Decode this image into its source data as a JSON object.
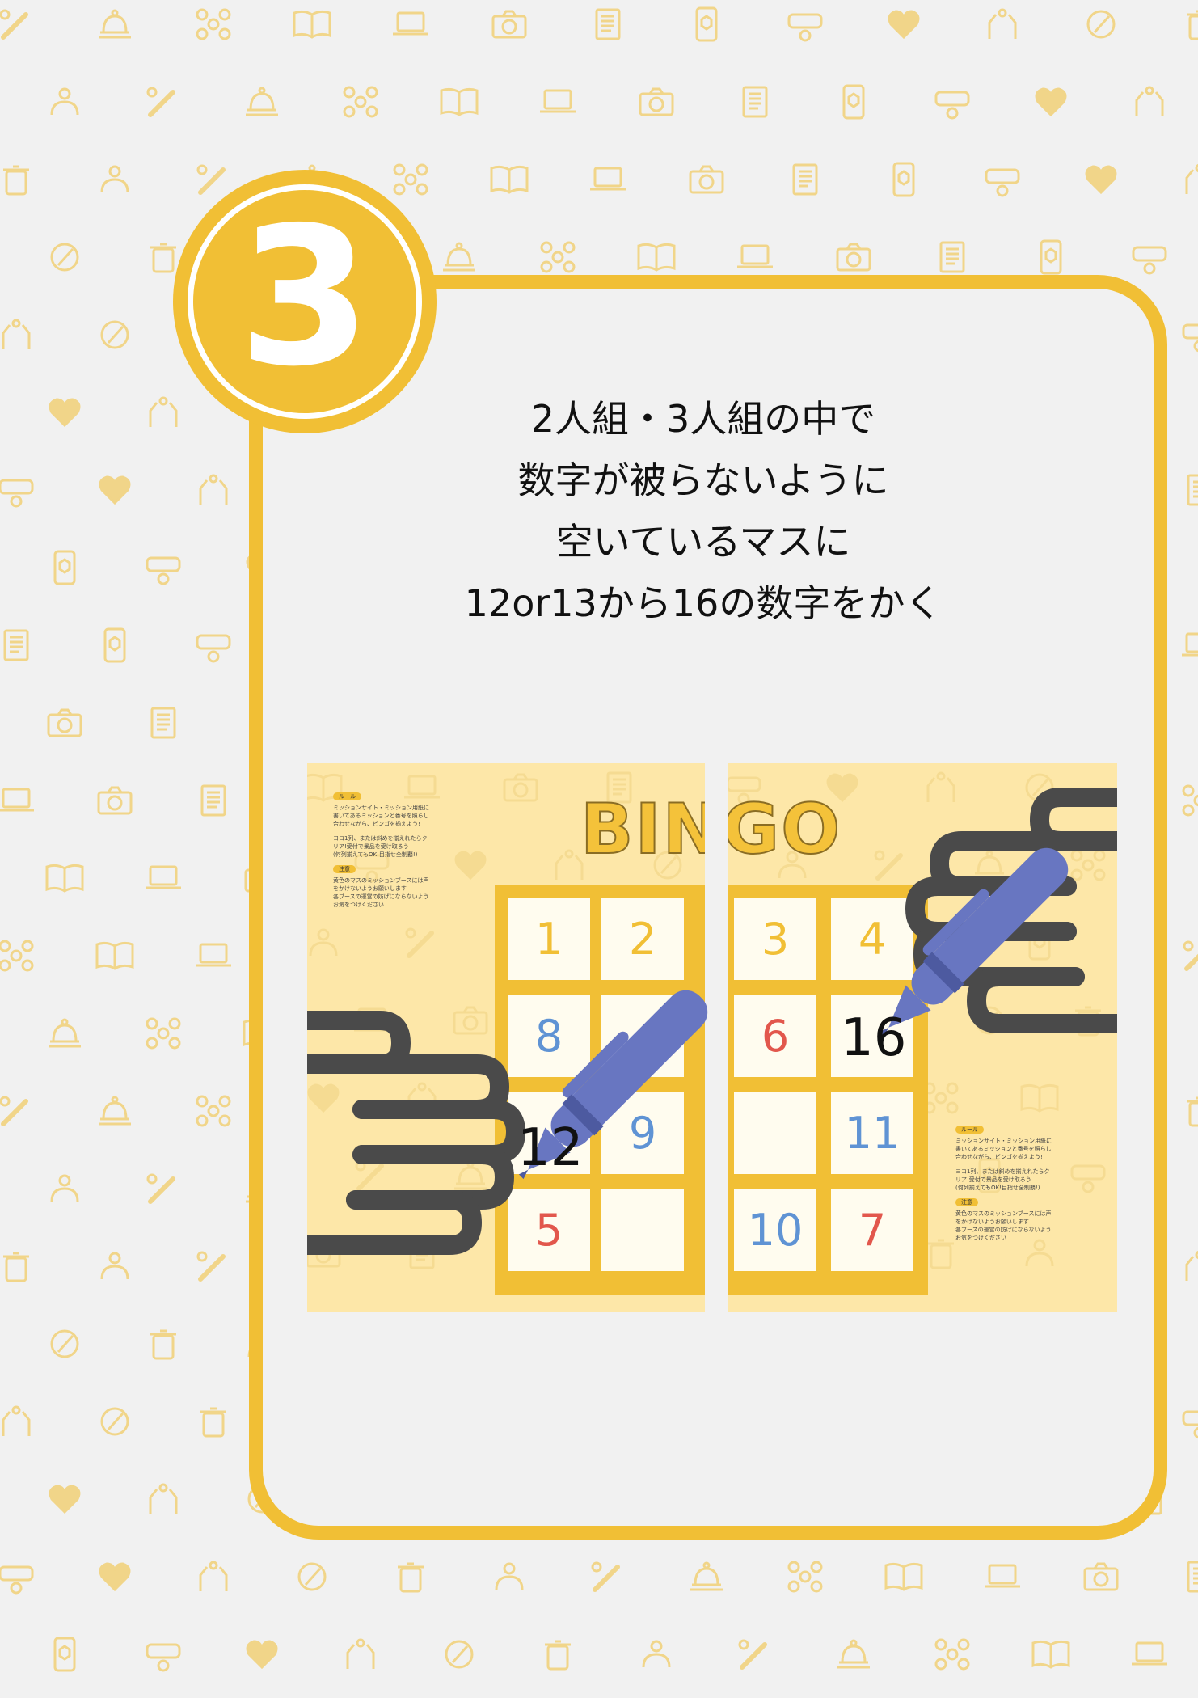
{
  "colors": {
    "accent": "#f1bf35",
    "background": "#f1f1f1",
    "sheet": "#fde7a8",
    "pen": "#6876c1",
    "hand": "#4a4a4a"
  },
  "step": {
    "number": "3"
  },
  "instructions": {
    "line1": "2人組・3人組の中で",
    "line2": "数字が被らないように",
    "line3": "空いているマスに",
    "line4": "12or13から16の数字をかく"
  },
  "bingo_title": "BINGO",
  "left_sheet": {
    "rule_tag": "ルール",
    "rule_text": "ミッションサイト・ミッション用紙に\n書いてあるミッションと番号を照らし\n合わせながら、ビンゴを揃えよう!",
    "rule_text2": "ヨコ1列、または斜めを揃えれたらク\nリア!受付で景品を受け取ろう\n(何列揃えてもOK!目指せ全制覇!)",
    "note_tag": "注意",
    "note_text": "黄色のマスのミッションブースには声\nをかけないようお願いします\n各ブースの運営の妨げにならないよう\nお気をつけください",
    "cells": [
      "1",
      "2",
      "8",
      "",
      "",
      "9",
      "5",
      ""
    ],
    "written": "12"
  },
  "right_sheet": {
    "cells": [
      "3",
      "4",
      "6",
      "",
      "",
      "11",
      "10",
      "7"
    ],
    "written": "16",
    "rule_tag": "ルール",
    "rule_text": "ミッションサイト・ミッション用紙に\n書いてあるミッションと番号を照らし\n合わせながら、ビンゴを揃えよう!",
    "rule_text2": "ヨコ1列、または斜めを揃えれたらク\nリア!受付で景品を受け取ろう\n(何列揃えてもOK!目指せ全制覇!)",
    "note_tag": "注意",
    "note_text": "黄色のマスのミッションブースには声\nをかけないようお願いします\n各ブースの運営の妨げにならないよう\nお気をつけください"
  },
  "icons": [
    "baseball-bat-icon",
    "bell-icon",
    "drone-icon",
    "book-icon",
    "laptop-icon",
    "camera-icon",
    "news-icon",
    "ar-phone-icon",
    "vr-headset-icon",
    "heart-icon",
    "hands-icon",
    "brush-icon",
    "trash-icon",
    "people-icon"
  ]
}
